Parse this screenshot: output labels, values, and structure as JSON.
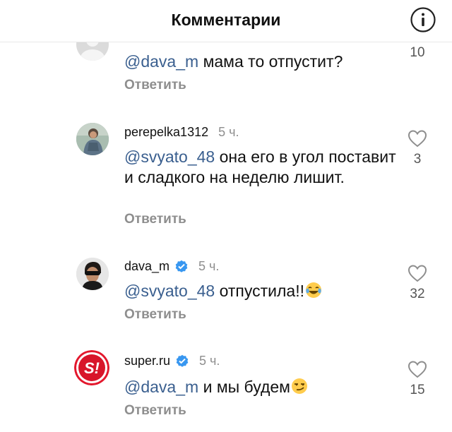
{
  "header": {
    "title": "Комментарии",
    "info_icon": "info-circle-icon"
  },
  "comments": [
    {
      "username": "",
      "time": "",
      "mention": "@dava_m",
      "text": " мама то отпустит?",
      "reply_label": "Ответить",
      "likes": "10",
      "verified": false,
      "avatar": "default-avatar"
    },
    {
      "username": "perepelka1312",
      "time": "5 ч.",
      "mention": "@svyato_48",
      "text": " она его в угол поставит и сладкого на неделю лишит.",
      "reply_label": "Ответить",
      "likes": "3",
      "verified": false,
      "avatar": "user-photo-avatar"
    },
    {
      "username": "dava_m",
      "time": "5 ч.",
      "mention": "@svyato_48",
      "text": " отпустила!!",
      "emoji": "laughing-tears-emoji",
      "reply_label": "Ответить",
      "likes": "32",
      "verified": true,
      "avatar": "user-photo-avatar"
    },
    {
      "username": "super.ru",
      "time": "5 ч.",
      "mention": "@dava_m",
      "text": " и мы будем",
      "emoji": "smirk-emoji",
      "reply_label": "Ответить",
      "likes": "15",
      "verified": true,
      "avatar": "super-logo-avatar",
      "avatar_logo": "S!"
    }
  ],
  "colors": {
    "mention": "#3a5f8f",
    "verified": "#3897f0",
    "secondary_text": "#8e8e8e",
    "super_red": "#e3182d"
  }
}
